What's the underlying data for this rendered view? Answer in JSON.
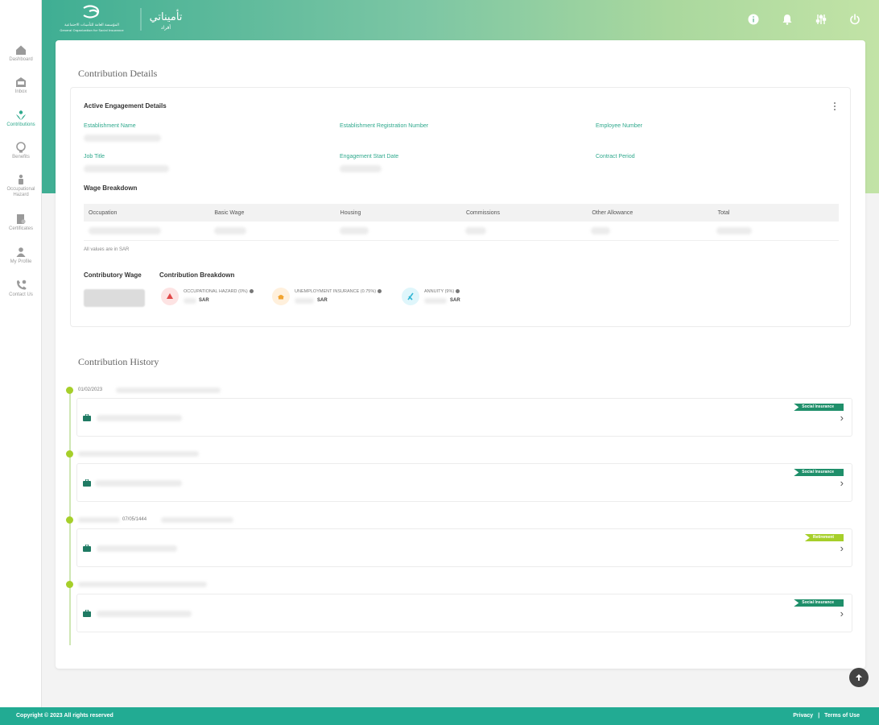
{
  "header": {
    "gosi_logo_text_ar": "المؤسسة العامة للتأمينات الاجتماعية",
    "gosi_logo_text_en": "General Organization for Social Insurance",
    "tam_logo_text": "تأميناتي",
    "tam_logo_sub": "أفراد",
    "icons": [
      "info-icon",
      "bell-icon",
      "settings-sliders-icon",
      "power-icon"
    ]
  },
  "sidebar": {
    "items": [
      {
        "label": "Dashboard",
        "icon": "home-icon"
      },
      {
        "label": "Inbox",
        "icon": "inbox-icon"
      },
      {
        "label": "Contributions",
        "icon": "contributions-icon"
      },
      {
        "label": "Benefits",
        "icon": "benefits-icon"
      },
      {
        "label": "Occupational",
        "label2": "Hazard",
        "icon": "occupational-hazard-icon"
      },
      {
        "label": "Certificates",
        "icon": "certificate-icon"
      },
      {
        "label": "My Profile",
        "icon": "profile-icon"
      },
      {
        "label": "Contact Us",
        "icon": "contact-icon"
      }
    ]
  },
  "details": {
    "title": "Contribution Details",
    "active_title": "Active Engagement Details",
    "labels": {
      "establishment_name": "Establishment Name",
      "establishment_reg": "Establishment Registration Number",
      "employee_number": "Employee Number",
      "job_title": "Job Title",
      "engagement_start": "Engagement Start Date",
      "contract_period": "Contract Period"
    },
    "wage_breakdown": {
      "title": "Wage Breakdown",
      "columns": [
        "Occupation",
        "Basic Wage",
        "Housing",
        "Commissions",
        "Other Allowance",
        "Total"
      ],
      "note": "All values are in SAR"
    },
    "contributory_wage_label": "Contributory Wage",
    "contribution_breakdown_label": "Contribution Breakdown",
    "breakdown": [
      {
        "name": "OCCUPATIONAL HAZARD (0%)",
        "currency": "SAR",
        "color": "#fde3e3",
        "icon_color": "#e04848"
      },
      {
        "name": "UNEMPLOYMENT INSURANCE (0.75%)",
        "currency": "SAR",
        "color": "#fff0dc",
        "icon_color": "#f2a431"
      },
      {
        "name": "ANNUITY (9%)",
        "currency": "SAR",
        "color": "#dff6fb",
        "icon_color": "#31b6d4"
      }
    ]
  },
  "history": {
    "title": "Contribution History",
    "entries": [
      {
        "date": "01/02/2023",
        "badge": "Social Insurance",
        "badge_color": "green"
      },
      {
        "date": "",
        "badge": "Social Insurance",
        "badge_color": "green"
      },
      {
        "date": "07/05/1444",
        "badge": "Retirement",
        "badge_color": "lime"
      },
      {
        "date": "",
        "badge": "Social Insurance",
        "badge_color": "green"
      }
    ]
  },
  "footer": {
    "copyright": "Copyright © 2023 All rights reserved",
    "privacy": "Privacy",
    "separator": "|",
    "terms": "Terms of Use"
  }
}
